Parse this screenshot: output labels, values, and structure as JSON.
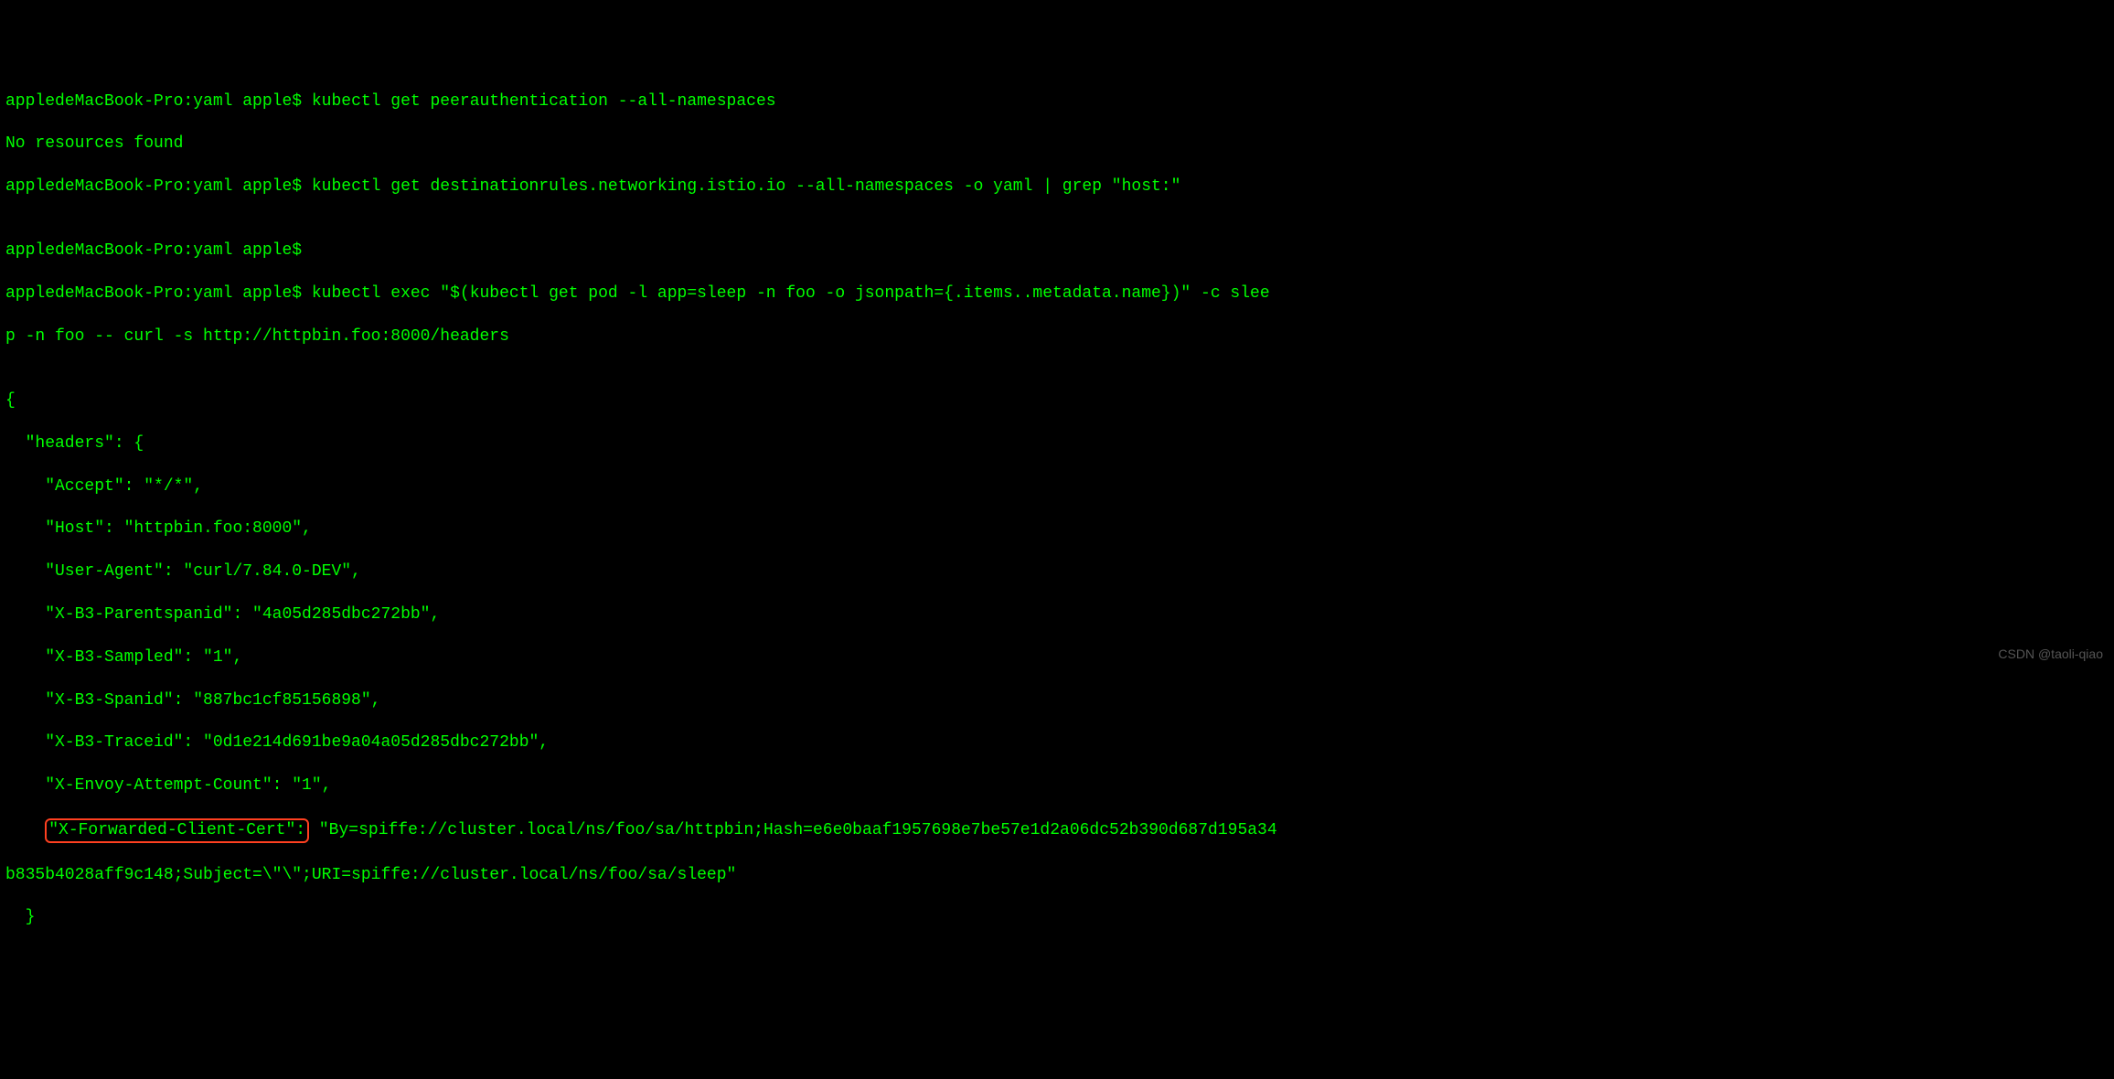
{
  "lines": {
    "l1_prompt": "appledeMacBook-Pro:yaml apple$ ",
    "l1_cmd": "kubectl get peerauthentication --all-namespaces",
    "l2_output": "No resources found",
    "l3_prompt": "appledeMacBook-Pro:yaml apple$ ",
    "l3_cmd": "kubectl get destinationrules.networking.istio.io --all-namespaces -o yaml | grep \"host:\"",
    "l4_blank": "",
    "l5_prompt": "appledeMacBook-Pro:yaml apple$ ",
    "l6_prompt": "appledeMacBook-Pro:yaml apple$ ",
    "l6_cmd": "kubectl exec \"$(kubectl get pod -l app=sleep -n foo -o jsonpath={.items..metadata.name})\" -c slee",
    "l7_cmd_cont": "p -n foo -- curl -s http://httpbin.foo:8000/headers",
    "l8_blank": "",
    "json_open": "{",
    "json_headers": "  \"headers\": {",
    "json_accept": "    \"Accept\": \"*/*\",",
    "json_host": "    \"Host\": \"httpbin.foo:8000\",",
    "json_useragent": "    \"User-Agent\": \"curl/7.84.0-DEV\",",
    "json_parentspan": "    \"X-B3-Parentspanid\": \"4a05d285dbc272bb\",",
    "json_sampled": "    \"X-B3-Sampled\": \"1\",",
    "json_spanid": "    \"X-B3-Spanid\": \"887bc1cf85156898\",",
    "json_traceid": "    \"X-B3-Traceid\": \"0d1e214d691be9a04a05d285dbc272bb\",",
    "json_envoy": "    \"X-Envoy-Attempt-Count\": \"1\",",
    "json_xfcc_indent": "    ",
    "json_xfcc_key": "\"X-Forwarded-Client-Cert\":",
    "json_xfcc_value": " \"By=spiffe://cluster.local/ns/foo/sa/httpbin;Hash=e6e0baaf1957698e7be57e1d2a06dc52b390d687d195a34",
    "json_xfcc_value2": "b835b4028aff9c148;Subject=\\\"\\\";URI=spiffe://cluster.local/ns/foo/sa/sleep\"",
    "json_close1": "  }"
  },
  "watermark": "CSDN @taoli-qiao"
}
